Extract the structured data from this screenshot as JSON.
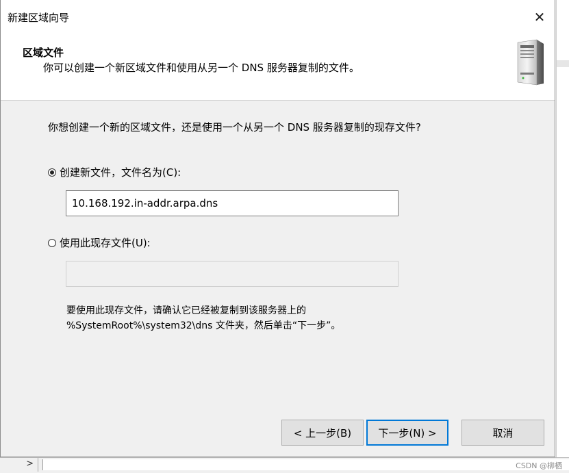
{
  "dialog": {
    "title": "新建区域向导",
    "close_glyph": "✕"
  },
  "header": {
    "title": "区域文件",
    "subtitle": "你可以创建一个新区域文件和使用从另一个 DNS 服务器复制的文件。",
    "icon": "server-icon"
  },
  "body": {
    "question": "你想创建一个新的区域文件，还是使用一个从另一个 DNS 服务器复制的现存文件?",
    "option_new": {
      "label": "创建新文件，文件名为(C):",
      "checked": true,
      "value": "10.168.192.in-addr.arpa.dns"
    },
    "option_existing": {
      "label": "使用此现存文件(U):",
      "checked": false,
      "value": ""
    },
    "hint_line1": "要使用此现存文件，请确认它已经被复制到该服务器上的",
    "hint_line2": "%SystemRoot%\\system32\\dns 文件夹，然后单击“下一步”。"
  },
  "buttons": {
    "back": "< 上一步(B)",
    "next": "下一步(N) >",
    "cancel": "取消"
  },
  "background": {
    "chevron": ">",
    "watermark": "CSDN @柳栖"
  }
}
